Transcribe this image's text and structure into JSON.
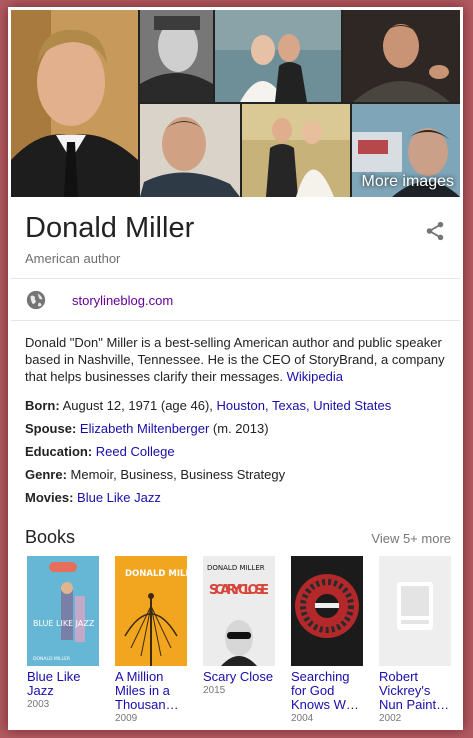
{
  "gallery": {
    "more_images_label": "More images"
  },
  "entity": {
    "name": "Donald Miller",
    "description": "American author",
    "website": "storylineblog.com"
  },
  "bio": {
    "text": "Donald \"Don\" Miller is a best-selling American author and public speaker based in Nashville, Tennessee. He is the CEO of StoryBrand, a company that helps businesses clarify their messages.",
    "source_link": "Wikipedia"
  },
  "facts": {
    "born": {
      "label": "Born:",
      "value": "August 12, 1971 (age 46),",
      "place_city": "Houston,",
      "place_state": "Texas,",
      "place_country": "United States"
    },
    "spouse": {
      "label": "Spouse:",
      "name": "Elizabeth Miltenberger",
      "detail": "(m. 2013)"
    },
    "education": {
      "label": "Education:",
      "value": "Reed College"
    },
    "genre": {
      "label": "Genre:",
      "value": "Memoir, Business, Business Strategy"
    },
    "movies": {
      "label": "Movies:",
      "value": "Blue Like Jazz"
    }
  },
  "books": {
    "heading": "Books",
    "view_more": "View 5+ more",
    "items": [
      {
        "title_line1": "Blue Like",
        "title_line2": "Jazz",
        "title_line3": "",
        "year": "2003",
        "cover_text": "BLUE LIKE JAZZ",
        "cover_author": "DONALD MILLER"
      },
      {
        "title_line1": "A Million",
        "title_line2": "Miles in a",
        "title_line3": "Thousan…",
        "year": "2009",
        "cover_text": "DONALD MILLER",
        "cover_author": ""
      },
      {
        "title_line1": "Scary Close",
        "title_line2": "",
        "title_line3": "",
        "year": "2015",
        "cover_text": "SCARY CLOSE",
        "cover_author": "DONALD MILLER"
      },
      {
        "title_line1": "Searching",
        "title_line2": "for God",
        "title_line3": "Knows W…",
        "year": "2004",
        "cover_text": "",
        "cover_author": ""
      },
      {
        "title_line1": "Robert",
        "title_line2": "Vickrey's",
        "title_line3": "Nun Paint…",
        "year": "2002",
        "cover_text": "",
        "cover_author": ""
      }
    ]
  },
  "colors": {
    "link": "#1a0dab",
    "visited_link": "#660099",
    "border": "#b25a62"
  }
}
